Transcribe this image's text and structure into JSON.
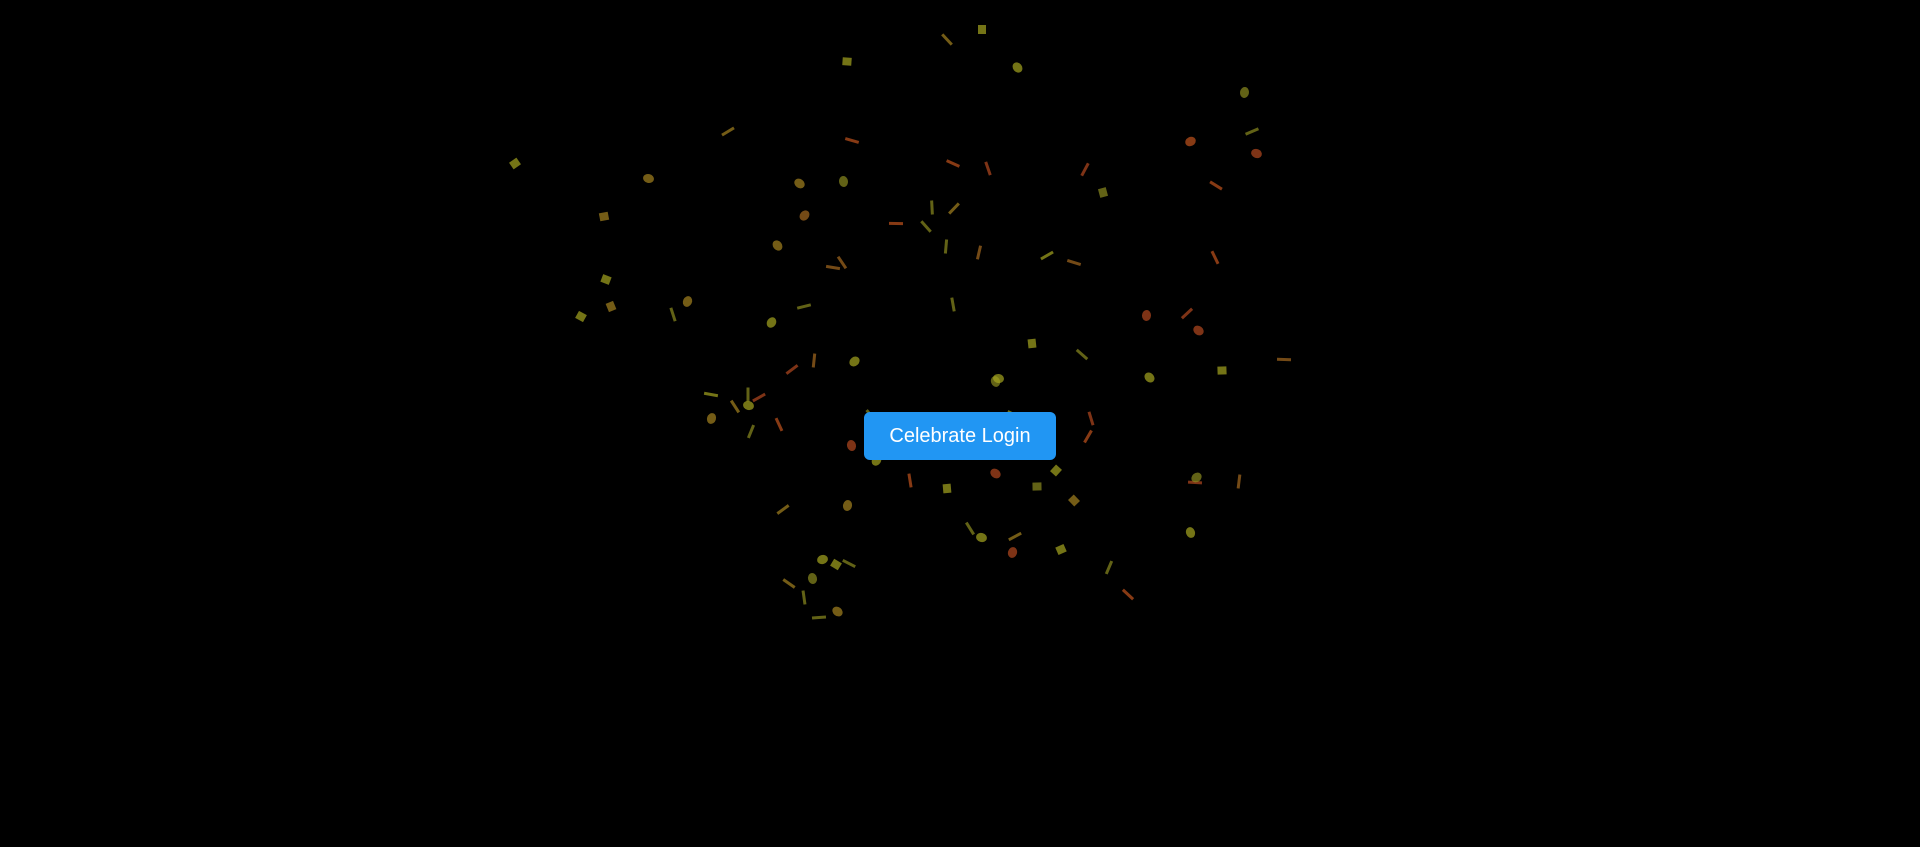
{
  "page": {
    "background_color": "#000000"
  },
  "celebrate_button": {
    "label": "Celebrate Login",
    "color": "#2196f3",
    "text_color": "#ffffff"
  },
  "confetti": {
    "colors": [
      "#a5a51f",
      "#a5831f",
      "#c0521c",
      "#b4481f",
      "#8c8c20",
      "#a56a1f"
    ],
    "shapes": [
      "circle",
      "rect",
      "strip"
    ]
  }
}
